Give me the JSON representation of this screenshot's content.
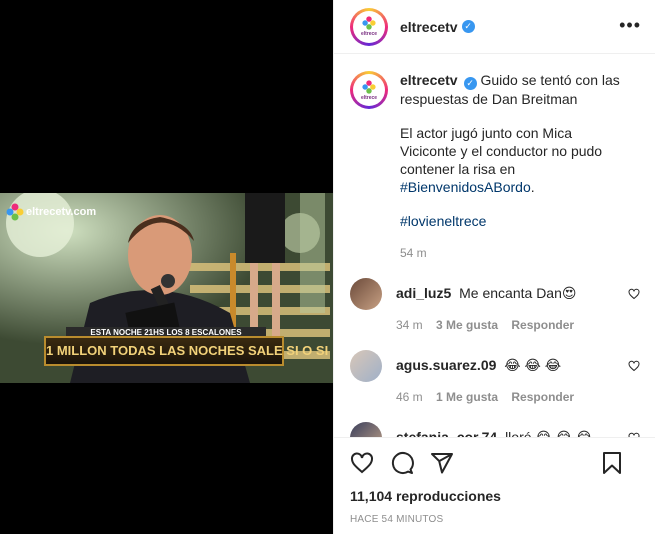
{
  "post": {
    "username": "eltrecetv",
    "verified_mark": "✓",
    "more_icon": "more-options-icon",
    "avatar_logo_text": "eltrece",
    "caption_title": "Guido se tentó con las respuestas de Dan Breitman",
    "caption_body_1": "El actor jugó junto con Mica Viciconte y el conductor no pudo contener la risa en ",
    "caption_hashtag_1": "#BienvenidosABordo",
    "caption_body_1_end": ".",
    "caption_hashtag_2": "#lovieneltrece",
    "caption_time": "54 m"
  },
  "video_overlay": {
    "logo": "eltrecetv.com",
    "banner_top": "ESTA NOCHE 21HS LOS 8 ESCALONES",
    "banner_main": "1 MILLON TODAS LAS NOCHES SALE SI O SI"
  },
  "comments": [
    {
      "username": "adi_luz5",
      "text": "Me encanta Dan",
      "emoji": "😍",
      "time": "34 m",
      "likes": "3 Me gusta",
      "reply": "Responder"
    },
    {
      "username": "agus.suarez.09",
      "text": "",
      "emoji": "😂 😂 😂",
      "time": "46 m",
      "likes": "1 Me gusta",
      "reply": "Responder"
    },
    {
      "username": "stefania_cor.74",
      "text": "lloré",
      "emoji": "😂 😂 😂",
      "time": "",
      "likes": "",
      "reply": ""
    }
  ],
  "footer": {
    "views": "11,104 reproducciones",
    "posted_ago": "HACE 54 MINUTOS"
  },
  "colors": {
    "link": "#00376b",
    "verified": "#3897f0",
    "muted": "#8e8e8e",
    "banner_text": "#f2d27a"
  }
}
